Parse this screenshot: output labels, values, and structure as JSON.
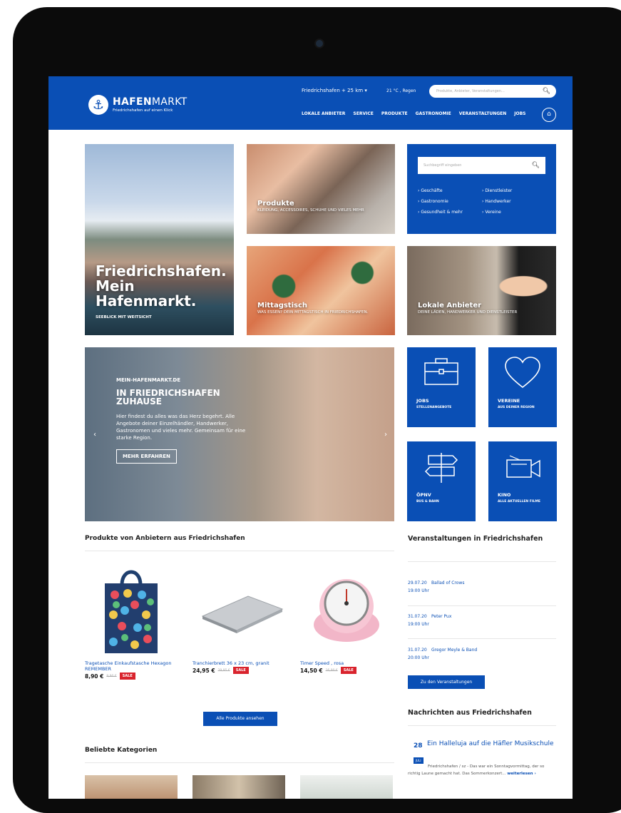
{
  "header": {
    "logo_brand_bold": "HAFEN",
    "logo_brand_regular": "MARKT",
    "logo_tagline": "Friedrichshafen auf einen Klick",
    "location": "Friedrichshafen + 25 km ▾",
    "weather": "21 °C , Regen",
    "search_placeholder": "Produkte, Anbieter, Veranstaltungen...",
    "nav": [
      "LOKALE ANBIETER",
      "SERVICE",
      "PRODUKTE",
      "GASTRONOMIE",
      "VERANSTALTUNGEN",
      "JOBS"
    ]
  },
  "tiles": {
    "hero": {
      "title_lines": [
        "Friedrichshafen.",
        "Mein",
        "Hafenmarkt."
      ],
      "subtitle": "SEEBLICK MIT WEITSICHT"
    },
    "produkte": {
      "title": "Produkte",
      "subtitle": "KLEIDUNG, ACCESSOIRES, SCHUHE UND VIELES MEHR"
    },
    "mittagstisch": {
      "title": "Mittagstisch",
      "subtitle": "WAS ESSEN? DEIN MITTAGSTISCH IN FRIEDRICHSHAFEN."
    },
    "lokale_anbieter": {
      "title": "Lokale Anbieter",
      "subtitle": "DEINE LÄDEN, HANDWERKER UND DIENSTLEISTER"
    }
  },
  "searchbox": {
    "placeholder": "Suchbegriff eingeben",
    "categories": [
      "Geschäfte",
      "Dienstleister",
      "Gastronomie",
      "Handwerker",
      "Gesundheit & mehr",
      "Vereine"
    ]
  },
  "carousel": {
    "kicker": "MEIN-HAFENMARKT.DE",
    "title": "IN FRIEDRICHSHAFEN ZUHAUSE",
    "body": "Hier findest du alles was das Herz begehrt. Alle Angebote deiner Einzelhändler, Handwerker, Gastronomen und vieles mehr. Gemeinsam für eine starke Region.",
    "button": "MEHR ERFAHREN",
    "prev": "‹",
    "next": "›"
  },
  "quicklinks": [
    {
      "label": "JOBS",
      "sub": "STELLENANGEBOTE"
    },
    {
      "label": "VEREINE",
      "sub": "AUS DEINER REGION"
    },
    {
      "label": "ÖPNV",
      "sub": "BUS & BAHN"
    },
    {
      "label": "KINO",
      "sub": "ALLE AKTUELLEN FILME"
    }
  ],
  "products_section": {
    "title": "Produkte von Anbietern aus Friedrichshafen",
    "items": [
      {
        "name": "Tragetasche Einkaufstasche Hexagon REMEMBER",
        "price": "8,90 €",
        "old": "9,90 €",
        "badge": "SALE"
      },
      {
        "name": "Tranchierbrett 36 x 23 cm, granit",
        "price": "24,95 €",
        "old": "29,95 €",
        "badge": "SALE"
      },
      {
        "name": "Timer Speed , rosa",
        "price": "14,50 €",
        "old": "16,90 €",
        "badge": "SALE"
      }
    ],
    "all_button": "Alle Produkte ansehen"
  },
  "events_section": {
    "title": "Veranstaltungen in Friedrichshafen",
    "items": [
      {
        "date": "29.07.20",
        "time": "19:00 Uhr",
        "title": "Ballad of Crows"
      },
      {
        "date": "31.07.20",
        "time": "19:00 Uhr",
        "title": "Peter Pux"
      },
      {
        "date": "31.07.20",
        "time": "20:00 Uhr",
        "title": "Gregor Meyle & Band"
      }
    ],
    "button": "Zu den Veranstaltungen"
  },
  "news_section": {
    "title": "Nachrichten aus Friedrichshafen",
    "day": "28",
    "month": "JULI",
    "headline": "Ein Halleluja auf die Häfler Musikschule",
    "body": "Friedrichshafen / sz - Das war ein Sonntagvormittag, der so richtig Laune gemacht hat. Das Sommerkonzert...",
    "more": "weiterlesen ›"
  },
  "categories_section": {
    "title": "Beliebte Kategorien"
  },
  "colors": {
    "brand": "#0a4fb5",
    "sale": "#d9232d"
  }
}
